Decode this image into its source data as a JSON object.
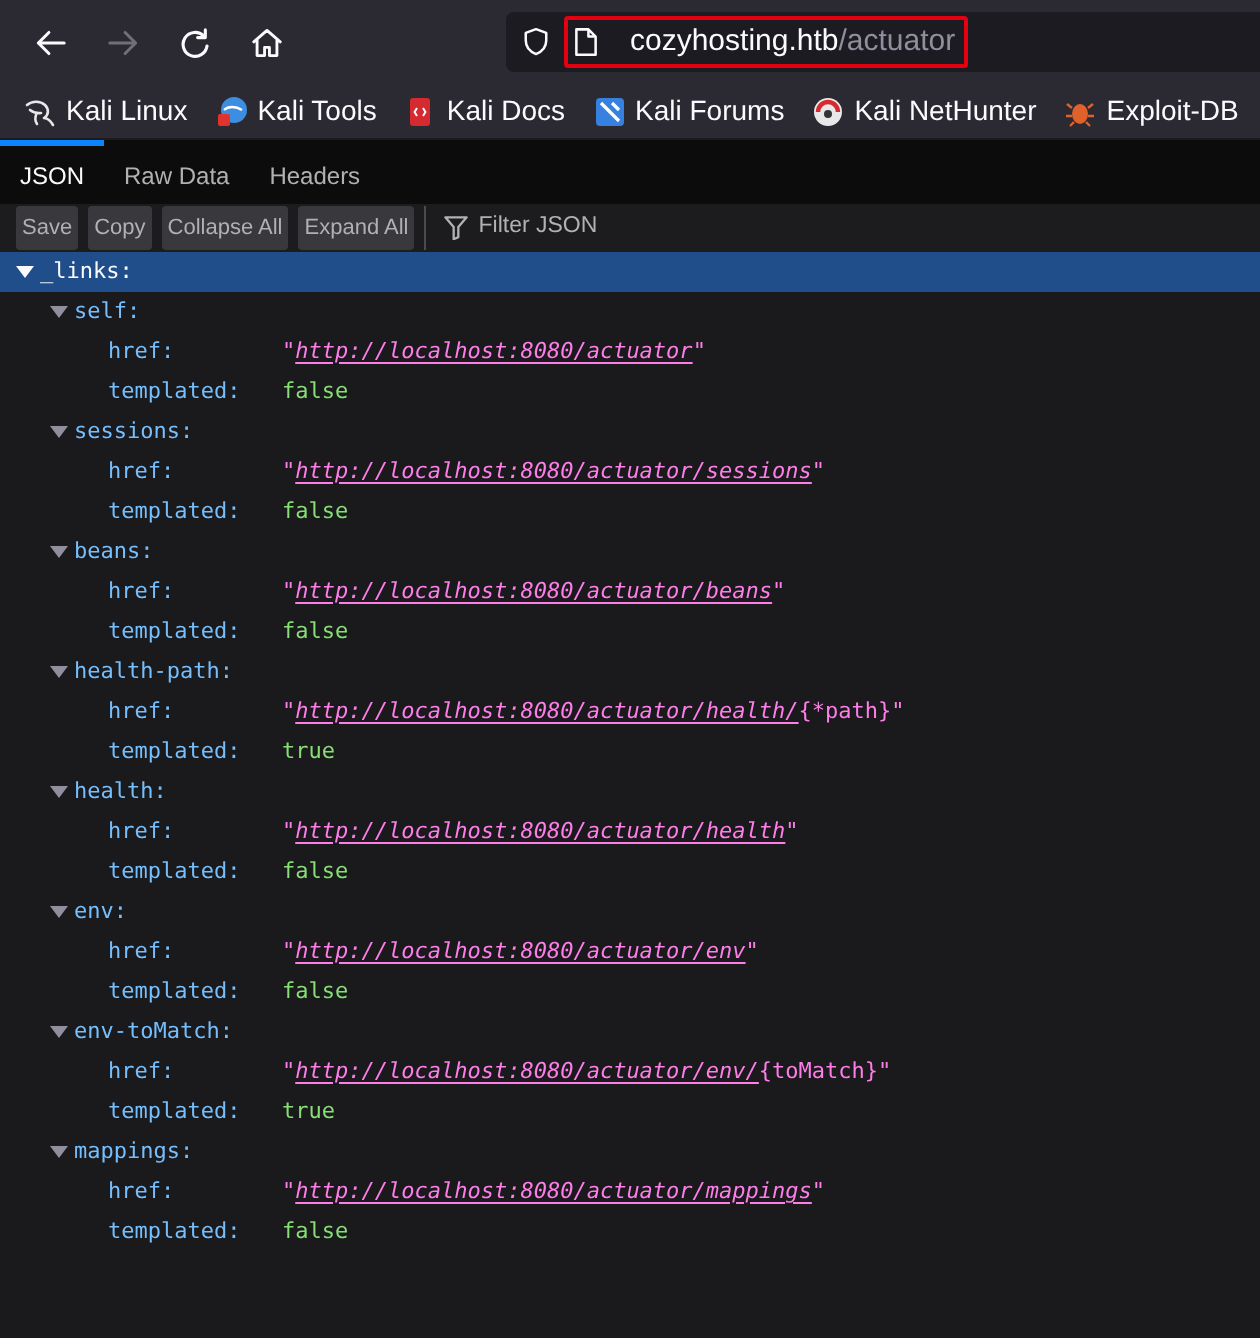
{
  "nav_buttons": [
    {
      "kind": "back",
      "disabled": false
    },
    {
      "kind": "forward",
      "disabled": true
    },
    {
      "kind": "reload",
      "disabled": false
    },
    {
      "kind": "home",
      "disabled": false
    }
  ],
  "address_bar": {
    "host": "cozyhosting.htb",
    "path": "/actuator",
    "highlighted": true
  },
  "bookmarks": [
    {
      "kind": "kali",
      "label": "Kali Linux"
    },
    {
      "kind": "tools",
      "label": "Kali Tools"
    },
    {
      "kind": "docs",
      "label": "Kali Docs"
    },
    {
      "kind": "forums",
      "label": "Kali Forums"
    },
    {
      "kind": "nethunter",
      "label": "Kali NetHunter"
    },
    {
      "kind": "exploitdb",
      "label": "Exploit-DB"
    }
  ],
  "viewer_tabs": [
    {
      "label": "JSON",
      "selected": true
    },
    {
      "label": "Raw Data",
      "selected": false
    },
    {
      "label": "Headers",
      "selected": false
    }
  ],
  "viewer_toolbar": {
    "buttons": [
      "Save",
      "Copy",
      "Collapse All",
      "Expand All"
    ],
    "filter": {
      "placeholder": "Filter JSON"
    }
  },
  "tree": {
    "label": "_links:",
    "expanded": true,
    "selected": true,
    "children": [
      {
        "label": "self:",
        "expanded": true,
        "selected": false,
        "children": [
          {
            "kind": "string",
            "label": "href:",
            "selected": false,
            "before": "\"",
            "link": "http://localhost:8080/actuator",
            "after": "\""
          },
          {
            "kind": "boolean",
            "label": "templated:",
            "selected": false,
            "value": "false"
          }
        ]
      },
      {
        "label": "sessions:",
        "expanded": true,
        "selected": false,
        "children": [
          {
            "kind": "string",
            "label": "href:",
            "selected": false,
            "before": "\"",
            "link": "http://localhost:8080/actuator/sessions",
            "after": "\""
          },
          {
            "kind": "boolean",
            "label": "templated:",
            "selected": false,
            "value": "false"
          }
        ]
      },
      {
        "label": "beans:",
        "expanded": true,
        "selected": false,
        "children": [
          {
            "kind": "string",
            "label": "href:",
            "selected": false,
            "before": "\"",
            "link": "http://localhost:8080/actuator/beans",
            "after": "\""
          },
          {
            "kind": "boolean",
            "label": "templated:",
            "selected": false,
            "value": "false"
          }
        ]
      },
      {
        "label": "health-path:",
        "expanded": true,
        "selected": false,
        "children": [
          {
            "kind": "string",
            "label": "href:",
            "selected": false,
            "before": "\"",
            "link": "http://localhost:8080/actuator/health/",
            "after": "{*path}\""
          },
          {
            "kind": "boolean",
            "label": "templated:",
            "selected": false,
            "value": "true"
          }
        ]
      },
      {
        "label": "health:",
        "expanded": true,
        "selected": false,
        "children": [
          {
            "kind": "string",
            "label": "href:",
            "selected": false,
            "before": "\"",
            "link": "http://localhost:8080/actuator/health",
            "after": "\""
          },
          {
            "kind": "boolean",
            "label": "templated:",
            "selected": false,
            "value": "false"
          }
        ]
      },
      {
        "label": "env:",
        "expanded": true,
        "selected": false,
        "children": [
          {
            "kind": "string",
            "label": "href:",
            "selected": false,
            "before": "\"",
            "link": "http://localhost:8080/actuator/env",
            "after": "\""
          },
          {
            "kind": "boolean",
            "label": "templated:",
            "selected": false,
            "value": "false"
          }
        ]
      },
      {
        "label": "env-toMatch:",
        "expanded": true,
        "selected": false,
        "children": [
          {
            "kind": "string",
            "label": "href:",
            "selected": false,
            "before": "\"",
            "link": "http://localhost:8080/actuator/env/",
            "after": "{toMatch}\""
          },
          {
            "kind": "boolean",
            "label": "templated:",
            "selected": false,
            "value": "true"
          }
        ]
      },
      {
        "label": "mappings:",
        "expanded": true,
        "selected": false,
        "children": [
          {
            "kind": "string",
            "label": "href:",
            "selected": false,
            "before": "\"",
            "link": "http://localhost:8080/actuator/mappings",
            "after": "\""
          },
          {
            "kind": "boolean",
            "label": "templated:",
            "selected": false,
            "value": "false"
          }
        ]
      }
    ]
  }
}
